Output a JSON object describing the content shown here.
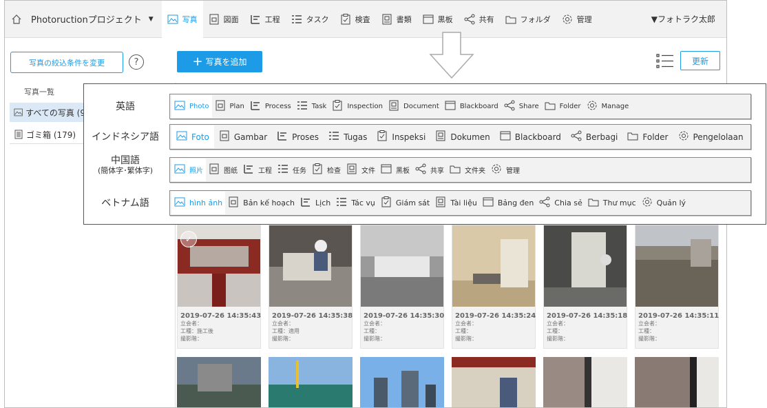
{
  "nav": {
    "project": "Photoructionプロジェクト",
    "items": [
      {
        "label": "写真",
        "icon": "photo-icon",
        "active": true
      },
      {
        "label": "図面",
        "icon": "drawing-icon"
      },
      {
        "label": "工程",
        "icon": "process-icon"
      },
      {
        "label": "タスク",
        "icon": "task-icon"
      },
      {
        "label": "検査",
        "icon": "inspection-icon"
      },
      {
        "label": "書類",
        "icon": "document-icon"
      },
      {
        "label": "黒板",
        "icon": "blackboard-icon"
      },
      {
        "label": "共有",
        "icon": "share-icon"
      },
      {
        "label": "フォルダ",
        "icon": "folder-icon"
      },
      {
        "label": "管理",
        "icon": "gear-icon"
      }
    ],
    "user": "▼フォトラク太郎"
  },
  "toolbar": {
    "filter_label": "写真の絞込条件を変更",
    "help_label": "?",
    "add_label": "写真を追加",
    "refresh_label": "更新"
  },
  "sidebar": {
    "title": "写真一覧",
    "items": [
      {
        "label": "すべての写真 (9",
        "icon": "photo-icon"
      },
      {
        "label": "ゴミ箱 (179)",
        "icon": "trash-icon"
      }
    ]
  },
  "photos": [
    {
      "date": "2019-07-26 14:35:43",
      "attendee": "立会者：",
      "process": "工種：施工後",
      "floor": "撮影階："
    },
    {
      "date": "2019-07-26 14:35:38",
      "attendee": "立会者：",
      "process": "工種：適用",
      "floor": "撮影階："
    },
    {
      "date": "2019-07-26 14:35:30",
      "attendee": "立会者：",
      "process": "工種：",
      "floor": "撮影階："
    },
    {
      "date": "2019-07-26 14:35:24",
      "attendee": "立会者：",
      "process": "工種：",
      "floor": "撮影階："
    },
    {
      "date": "2019-07-26 14:35:18",
      "attendee": "立会者：",
      "process": "工種：",
      "floor": "撮影階："
    },
    {
      "date": "2019-07-26 14:35:11",
      "attendee": "立会者：",
      "process": "工種：",
      "floor": "撮影階："
    }
  ],
  "languages": [
    {
      "name": "英語",
      "sub": "",
      "items": [
        "Photo",
        "Plan",
        "Process",
        "Task",
        "Inspection",
        "Document",
        "Blackboard",
        "Share",
        "Folder",
        "Manage"
      ]
    },
    {
      "name": "インドネシア語",
      "sub": "",
      "items": [
        "Foto",
        "Gambar",
        "Proses",
        "Tugas",
        "Inspeksi",
        "Dokumen",
        "Blackboard",
        "Berbagi",
        "Folder",
        "Pengelolaan"
      ]
    },
    {
      "name": "中国語",
      "sub": "(簡体字･繁体字)",
      "items": [
        "照片",
        "图纸",
        "工程",
        "任务",
        "检查",
        "文件",
        "黑板",
        "共享",
        "文件夹",
        "管理"
      ]
    },
    {
      "name": "ベトナム語",
      "sub": "",
      "items": [
        "hình ảnh",
        "Bản kế hoạch",
        "Lịch",
        "Tác vụ",
        "Giám sát",
        "Tài liệu",
        "Bảng đen",
        "Chia sẻ",
        "Thư mục",
        "Quản lý"
      ]
    }
  ],
  "colors": {
    "accent": "#1e9be6",
    "nav_bg": "#f2f2f2",
    "active_side": "#dbe9f6"
  }
}
